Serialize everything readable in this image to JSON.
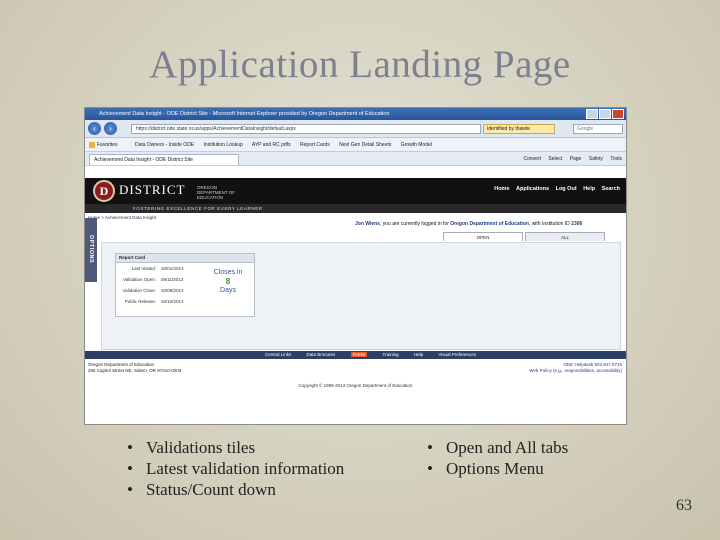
{
  "slide": {
    "title": "Application Landing Page",
    "bullets_left": [
      "Validations tiles",
      "Latest validation information",
      "Status/Count down"
    ],
    "bullets_right": [
      "Open and All tabs",
      "Options Menu"
    ],
    "page_number": "63"
  },
  "browser": {
    "window_title": "Achievement Data Insight - ODE District Site - Microsoft Internet Explorer provided by Oregon Department of Education",
    "url": "https://district.ode.state.or.us/apps/AchievementDataInsight/default.aspx",
    "identity": "Identified by thawte",
    "search_placeholder": "Google",
    "favorites_label": "Favorites",
    "favorites": [
      "Data Owners - Inside ODE",
      "Institution Lookup",
      "AYP and RC pdfs",
      "Report Cards",
      "Next Gen Detail Sheets",
      "Growth Model"
    ],
    "tab_label": "Achievement Data Insight - ODE District Site",
    "toolbar": [
      "Page",
      "Safety",
      "Tools"
    ],
    "convert_label": "Convert",
    "select_label": "Select"
  },
  "site": {
    "logo_letter": "D",
    "brand": "DISTRICT",
    "org_line1": "OREGON",
    "org_line2": "DEPARTMENT OF",
    "org_line3": "EDUCATION",
    "nav": [
      "Home",
      "Applications",
      "Log Out",
      "Help",
      "Search"
    ],
    "tagline": "FOSTERING EXCELLENCE FOR EVERY LEARNER",
    "breadcrumb": "Home > Achievement Data Insight",
    "options_label": "OPTIONS",
    "welcome_user": "Jon Wiens",
    "welcome_mid": ", you are currently logged in for ",
    "welcome_org": "Oregon Department of Education",
    "welcome_inst": ", with Institution ID ",
    "welcome_id": "2306",
    "tabs": [
      "OPEN",
      "ALL"
    ]
  },
  "report_card": {
    "header": "Report Card",
    "rows": [
      {
        "label": "Last Visited:",
        "value": "10/01/2013"
      },
      {
        "label": "Validation Open:",
        "value": "09/11/2013"
      },
      {
        "label": "Validation Close:",
        "value": "10/09/2013"
      },
      {
        "label": "Public Release:",
        "value": "10/10/2013"
      }
    ],
    "closes_label": "Closes in",
    "closes_num": "8",
    "closes_unit": "Days"
  },
  "footer": {
    "nav": [
      "Central Links",
      "Data Brocures",
      "Forms",
      "Training",
      "Help",
      "Visual Preferences"
    ],
    "address_line1": "Oregon Department of Education",
    "address_line2": "255 Capitol Street NE, Salem, OR 97310-0203",
    "helpdesk": "ODE Helpdesk",
    "phone": "503.947.5715",
    "web_policy": "Web Policy",
    "policy_note": "(e.g., responsibilities, accessibility)",
    "copyright": "Copyright © 1999-2013 Oregon Department of Education"
  }
}
